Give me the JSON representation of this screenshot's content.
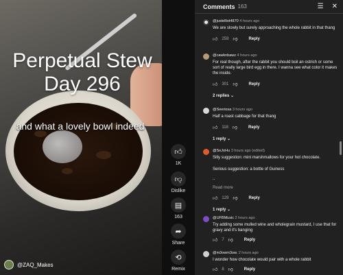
{
  "video": {
    "title_line1": "Perpetual Stew",
    "title_line2": "Day 296",
    "caption": "and what a lovely bowl indeed",
    "channel": "@ZAQ_Makes"
  },
  "actions": {
    "like_count": "1K",
    "dislike_label": "Dislike",
    "comment_count": "163",
    "share_label": "Share",
    "remix_label": "Remix"
  },
  "comments_panel": {
    "title": "Comments",
    "count": "163",
    "comments": [
      {
        "user": "@justelliot4870",
        "time": "4 hours ago",
        "text": "We are slowly but surely approaching the whole rabbit in that thang",
        "likes": "259",
        "avatar_color": "#e8e8e8"
      },
      {
        "user": "@cawknbawz",
        "time": "4 hours ago",
        "text": "For real though, after the rabbit you should boil an ostrich or some sort of really large bird egg in there. I wanna see what color it makes the inside.",
        "likes": "301",
        "replies": "2 replies",
        "avatar_color": "#b99a77"
      },
      {
        "user": "@Seeriosa",
        "time": "3 hours ago",
        "text": "Half a roast cabbage for that thang",
        "likes": "118",
        "replies": "1 reply",
        "avatar_color": "#d8d8d8"
      },
      {
        "user": "@SeJoHu",
        "time": "3 hours ago (edited)",
        "text": "Silly suggestion: mini marshmallows for your hot chocolate.",
        "text2": "Serious suggestion: a bottle of Guiness",
        "text3": "..",
        "read_more": "Read more",
        "likes": "129",
        "replies": "1 reply",
        "avatar_color": "#e05a2b"
      },
      {
        "user": "@UFBMusic",
        "time": "2 hours ago",
        "text": "Try adding some mulled wine and wholegrain mustard, I use that for gravy and it's banging",
        "likes": "7",
        "avatar_color": "#7d4bc4"
      },
      {
        "user": "@m3owm3ow.",
        "time": "2 hours ago",
        "text": "I wonder how chocolate would pair with a whole rabbit",
        "likes": "8",
        "avatar_color": "#cfcfcf"
      }
    ],
    "reply_label": "Reply"
  },
  "icons": {
    "like": "thumb-up-icon",
    "dislike": "thumb-down-icon",
    "comment": "comment-icon",
    "share": "share-icon",
    "remix": "remix-icon",
    "sort": "sort-icon",
    "close": "close-icon"
  }
}
